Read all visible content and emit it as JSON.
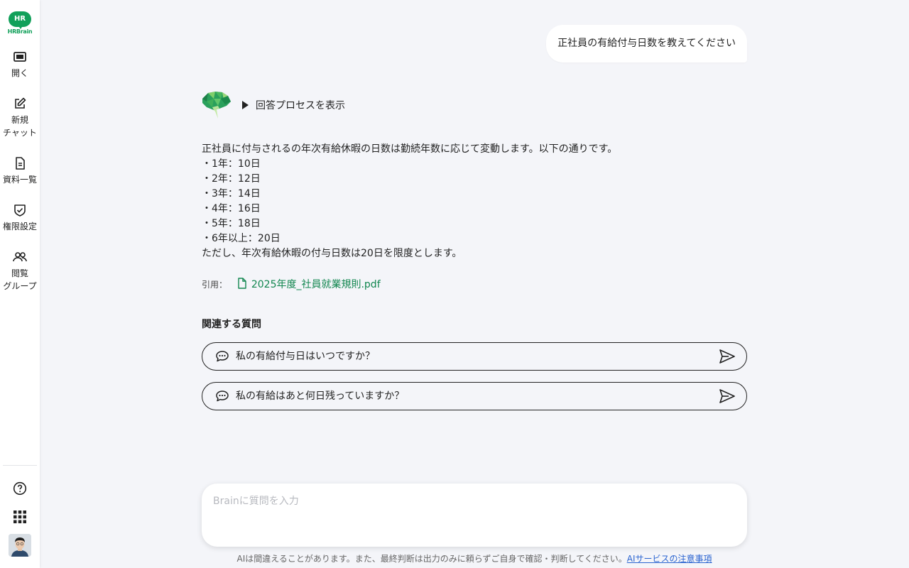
{
  "brand": {
    "logo_badge": "HR",
    "logo_word": "HRBrain",
    "color": "#11a05a"
  },
  "sidebar": {
    "items": [
      {
        "label": "開く",
        "icon": "panel-icon"
      },
      {
        "label": "新規\nチャット",
        "icon": "edit-icon"
      },
      {
        "label": "資料一覧",
        "icon": "document-icon"
      },
      {
        "label": "権限設定",
        "icon": "shield-check-icon"
      },
      {
        "label": "閲覧\nグループ",
        "icon": "users-icon"
      }
    ],
    "bottom": [
      "help-icon",
      "apps-grid-icon",
      "avatar"
    ]
  },
  "chat": {
    "user_message": "正社員の有給付与日数を教えてください",
    "process_toggle": "回答プロセスを表示",
    "answer_lines": [
      "正社員に付与されるの年次有給休暇の日数は勤続年数に応じて変動します。以下の通りです。",
      "・1年：10日",
      "・2年：12日",
      "・3年：14日",
      "・4年：16日",
      "・5年：18日",
      "・6年以上：20日",
      "ただし、年次有給休暇の付与日数は20日を限度とします。"
    ],
    "citation_label": "引用：",
    "citation_file": "2025年度_社員就業規則.pdf",
    "related_title": "関連する質問",
    "related_questions": [
      "私の有給付与日はいつですか？",
      "私の有給はあと何日残っていますか？"
    ]
  },
  "input": {
    "placeholder": "Brainに質問を入力",
    "value": ""
  },
  "disclaimer": {
    "text": "AIは間違えることがあります。また、最終判断は出力のみに頼らずご自身で確認・判断してください。",
    "link": "AIサービスの注意事項"
  },
  "colors": {
    "accent": "#11864f",
    "link": "#2a64d0",
    "background": "#f4f5f9"
  }
}
